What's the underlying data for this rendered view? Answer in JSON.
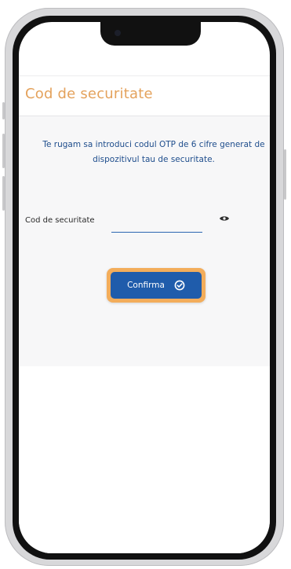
{
  "page": {
    "title": "Cod de securitate",
    "instruction_line1": "Te rugam sa introduci codul OTP de 6 cifre generat de",
    "instruction_line2": "dispozitivul tau de securitate."
  },
  "form": {
    "field_label": "Cod de securitate",
    "field_value": "",
    "confirm_label": "Confirma"
  },
  "icons": {
    "visibility": "eye-icon",
    "confirm": "check-circle-icon"
  },
  "colors": {
    "title": "#e4a25c",
    "instruction": "#1e4d8c",
    "button": "#1f5cab",
    "button_focus_ring": "#f3ad5b",
    "input_underline": "#2d67b2"
  }
}
